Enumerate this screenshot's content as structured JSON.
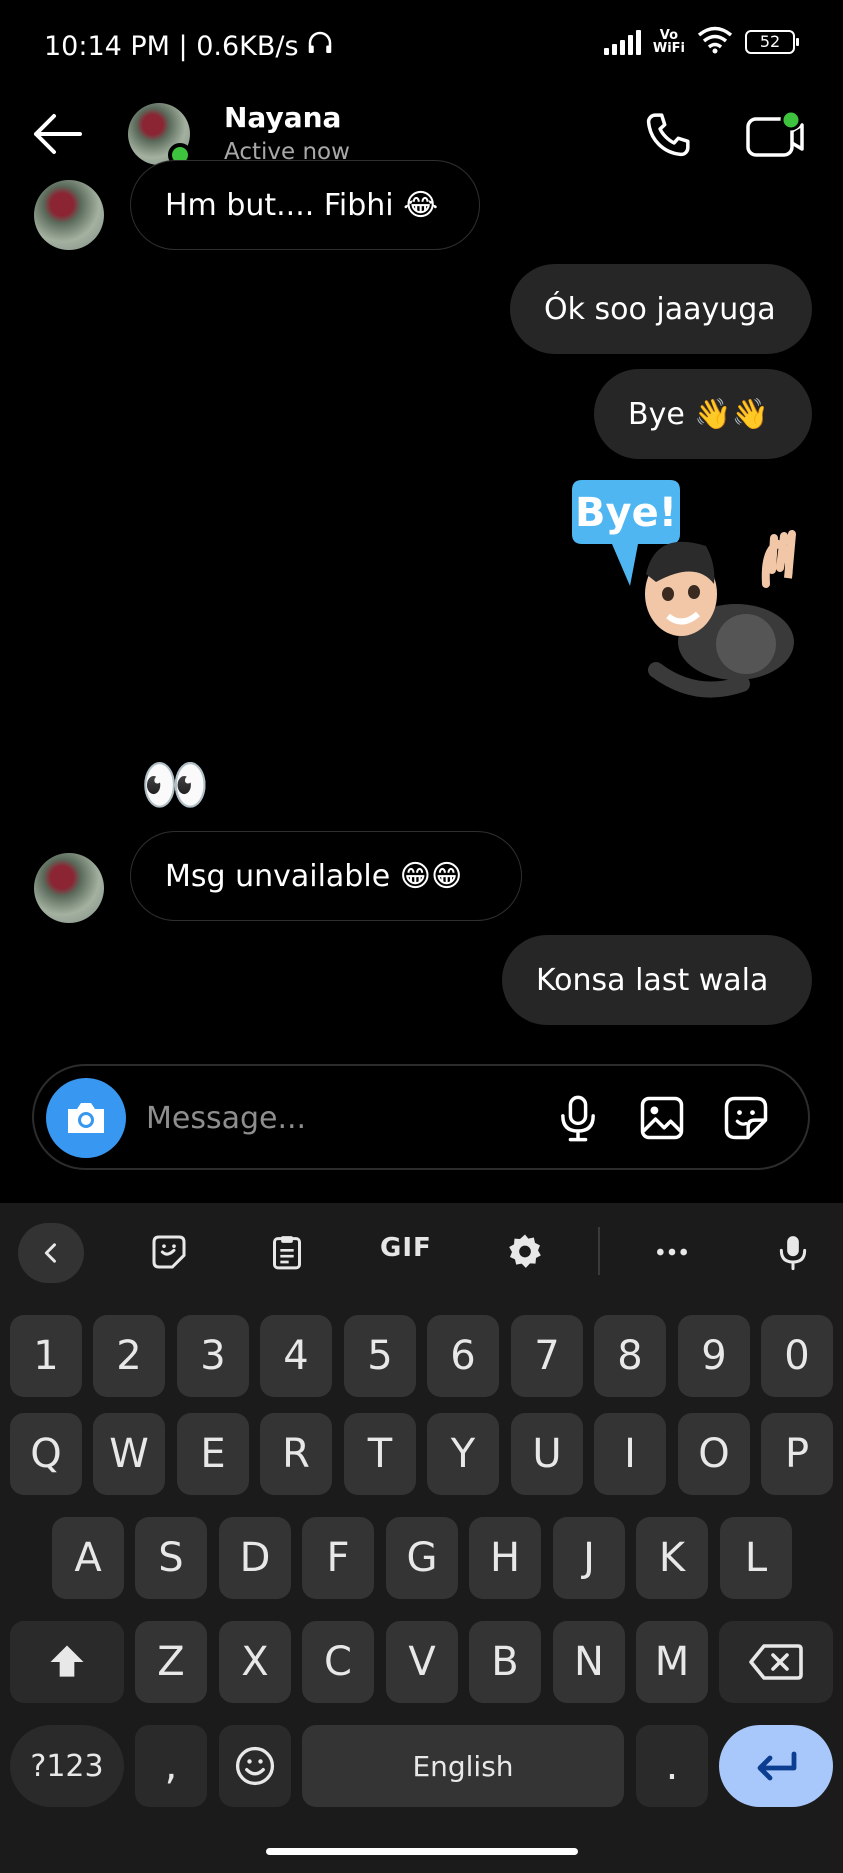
{
  "status_bar": {
    "time": "10:14 PM | 0.6KB/s",
    "vowifi_top": "Vo",
    "vowifi_bottom": "WiFi",
    "battery": "52"
  },
  "header": {
    "contact_name": "Nayana",
    "contact_status": "Active now"
  },
  "messages": [
    {
      "direction": "in",
      "text": "Hm but.... Fibhi 😂"
    },
    {
      "direction": "out",
      "text": "Ók soo jaayuga"
    },
    {
      "direction": "out",
      "text": "Bye 👋👋"
    },
    {
      "direction": "out",
      "type": "sticker",
      "sticker_text": "Bye!"
    },
    {
      "direction": "in",
      "type": "emoji",
      "text": "👀"
    },
    {
      "direction": "in",
      "text": "Msg unvailable 😁😁"
    },
    {
      "direction": "out",
      "text": "Konsa last wala"
    }
  ],
  "composer": {
    "placeholder": "Message..."
  },
  "keyboard": {
    "toolbar_gif": "GIF",
    "number_row": [
      "1",
      "2",
      "3",
      "4",
      "5",
      "6",
      "7",
      "8",
      "9",
      "0"
    ],
    "row1": [
      "Q",
      "W",
      "E",
      "R",
      "T",
      "Y",
      "U",
      "I",
      "O",
      "P"
    ],
    "row2": [
      "A",
      "S",
      "D",
      "F",
      "G",
      "H",
      "J",
      "K",
      "L"
    ],
    "row3": [
      "Z",
      "X",
      "C",
      "V",
      "B",
      "N",
      "M"
    ],
    "symbols_key": "?123",
    "comma_key": ",",
    "space_label": "English",
    "period_key": "."
  },
  "colors": {
    "accent_blue": "#3897f0",
    "online_green": "#3ec33e",
    "enter_key": "#a8c7fa",
    "outgoing_bubble": "#262626"
  }
}
